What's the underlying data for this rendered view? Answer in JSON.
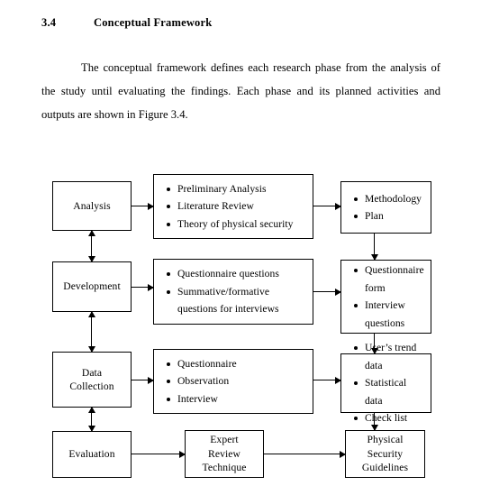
{
  "document": {
    "section_number": "3.4",
    "section_title": "Conceptual Framework",
    "paragraph": "The conceptual framework defines each research phase from the analysis of the study until evaluating the findings. Each phase and its planned activities and outputs are shown in Figure 3.4."
  },
  "diagram": {
    "phases": [
      {
        "label": "Analysis"
      },
      {
        "label": "Development"
      },
      {
        "label": "Data\nCollection"
      },
      {
        "label": "Evaluation"
      }
    ],
    "activities": [
      {
        "items": [
          "Preliminary Analysis",
          "Literature Review",
          "Theory of physical security"
        ]
      },
      {
        "items": [
          "Questionnaire questions",
          "Summative/formative",
          "questions for interviews"
        ]
      },
      {
        "items": [
          "Questionnaire",
          "Observation",
          "Interview"
        ]
      }
    ],
    "outputs": [
      {
        "items": [
          "Methodology",
          "Plan"
        ]
      },
      {
        "items": [
          "Questionnaire",
          "form",
          "Interview",
          "questions"
        ]
      },
      {
        "items": [
          "User’s trend data",
          "Statistical data",
          "Check list"
        ]
      }
    ],
    "bottom_row": {
      "phase": "Evaluation",
      "middle": "Expert\nReview\nTechnique",
      "output": "Physical\nSecurity\nGuidelines"
    }
  }
}
